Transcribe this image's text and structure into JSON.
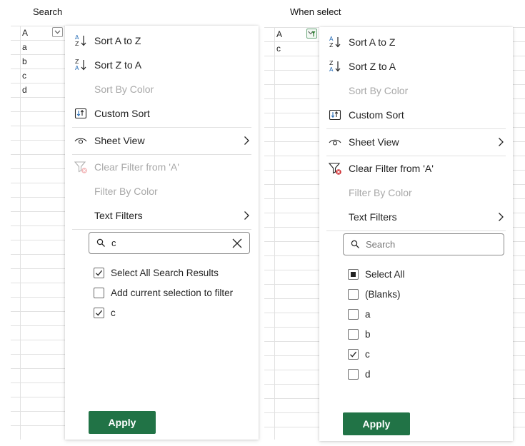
{
  "left_panel": {
    "caption": "Search",
    "cells": [
      "A",
      "a",
      "b",
      "c",
      "d"
    ],
    "menu": {
      "sort_az": "Sort A to Z",
      "sort_za": "Sort Z to A",
      "sort_by_color": "Sort By Color",
      "custom_sort": "Custom Sort",
      "sheet_view": "Sheet View",
      "clear_filter": "Clear Filter from 'A'",
      "filter_by_color": "Filter By Color",
      "text_filters": "Text Filters",
      "search_value": "c",
      "options": [
        {
          "label": "Select All Search Results",
          "state": "checked"
        },
        {
          "label": "Add current selection to filter",
          "state": "unchecked"
        },
        {
          "label": "c",
          "state": "checked"
        }
      ],
      "apply": "Apply"
    }
  },
  "right_panel": {
    "caption": "When select",
    "cells": [
      "A",
      "c"
    ],
    "menu": {
      "sort_az": "Sort A to Z",
      "sort_za": "Sort Z to A",
      "sort_by_color": "Sort By Color",
      "custom_sort": "Custom Sort",
      "sheet_view": "Sheet View",
      "clear_filter": "Clear Filter from 'A'",
      "filter_by_color": "Filter By Color",
      "text_filters": "Text Filters",
      "search_placeholder": "Search",
      "options": [
        {
          "label": "Select All",
          "state": "indeterminate"
        },
        {
          "label": "(Blanks)",
          "state": "unchecked"
        },
        {
          "label": "a",
          "state": "unchecked"
        },
        {
          "label": "b",
          "state": "unchecked"
        },
        {
          "label": "c",
          "state": "checked"
        },
        {
          "label": "d",
          "state": "unchecked"
        }
      ],
      "apply": "Apply"
    }
  },
  "colors": {
    "apply_green": "#217346",
    "sort_blue": "#2b6fb6",
    "clear_filter_red": "#d13438",
    "filter_active_green": "#2e7d32"
  }
}
